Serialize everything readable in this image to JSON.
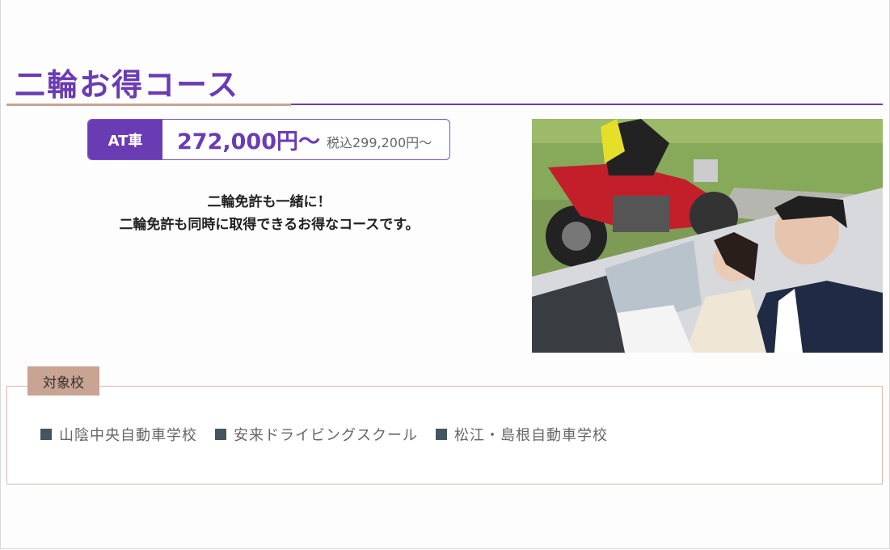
{
  "course": {
    "title": "二輪お得コース"
  },
  "price": {
    "tag": "AT車",
    "main": "272,000円〜",
    "tax_included": "税込299,200円〜"
  },
  "description": {
    "line1": "二輪免許も一緒に！",
    "line2": "二輪免許も同時に取得できるお得なコースです。"
  },
  "schools": {
    "label": "対象校",
    "items": [
      {
        "name": "山陰中央自動車学校"
      },
      {
        "name": "安来ドライビングスクール"
      },
      {
        "name": "松江・島根自動車学校"
      }
    ]
  },
  "colors": {
    "accent": "#6a3cb4",
    "tan": "#c9a493",
    "marker": "#44555f"
  }
}
